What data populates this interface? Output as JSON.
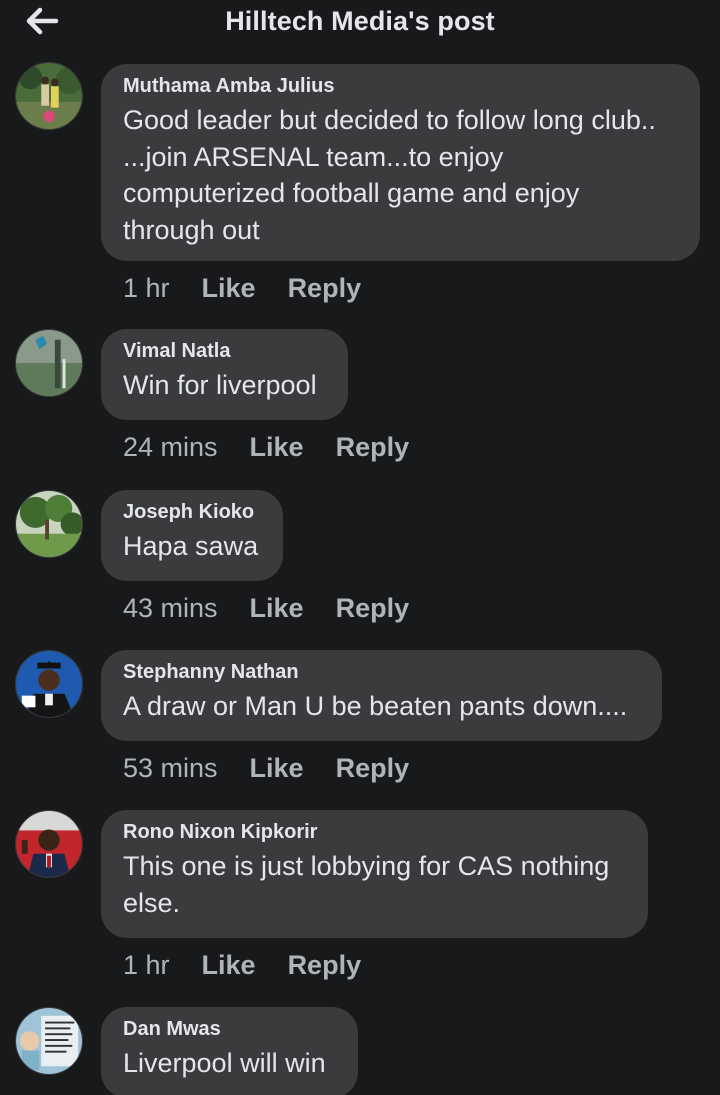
{
  "header": {
    "title": "Hilltech Media's post"
  },
  "colors": {
    "background": "#18191a",
    "bubble": "#3a3b3c",
    "text_primary": "#e4e6eb",
    "text_secondary": "#b0b3b8"
  },
  "comments": [
    {
      "author": "Muthama Amba Julius",
      "text": "Good leader but decided to follow long club..\n...join ARSENAL team...to enjoy\ncomputerized football game and enjoy\nthrough out",
      "time": "1 hr",
      "like_label": "Like",
      "reply_label": "Reply"
    },
    {
      "author": "Vimal Natla",
      "text": "Win for liverpool",
      "time": "24 mins",
      "like_label": "Like",
      "reply_label": "Reply"
    },
    {
      "author": "Joseph Kioko",
      "text": "Hapa sawa",
      "time": "43 mins",
      "like_label": "Like",
      "reply_label": "Reply"
    },
    {
      "author": "Stephanny Nathan",
      "text": "A draw or Man U be beaten pants down....",
      "time": "53 mins",
      "like_label": "Like",
      "reply_label": "Reply"
    },
    {
      "author": "Rono Nixon Kipkorir",
      "text": "This one is just lobbying for CAS nothing\nelse.",
      "time": "1 hr",
      "like_label": "Like",
      "reply_label": "Reply"
    },
    {
      "author": "Dan Mwas",
      "text": "Liverpool will win",
      "time": "",
      "like_label": "",
      "reply_label": ""
    }
  ]
}
